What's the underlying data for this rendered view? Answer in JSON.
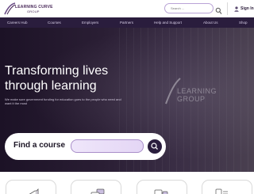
{
  "header": {
    "logo_text": "LEARNING CURVE",
    "logo_sub": "GROUP",
    "search_placeholder": "Search ...",
    "signin_label": "Sign In"
  },
  "nav": {
    "items": [
      "Careers Hub",
      "Courses",
      "Employers",
      "Partners",
      "Help and Support",
      "About Us",
      "Shop"
    ]
  },
  "hero": {
    "title": "Transforming lives through learning",
    "subtitle": "We make sure government funding for education goes to the people who need and want it the most",
    "logo_text_1": "LEARNING",
    "logo_text_2": "GROUP"
  },
  "find_course": {
    "label": "Find a course",
    "placeholder": ""
  },
  "icons": {
    "search": "search-icon",
    "user": "user-icon",
    "find_search": "search-icon"
  },
  "colors": {
    "brand_purple": "#2a1d3d",
    "accent_lavender": "#b9a3d6",
    "logo_purple": "#4a2a5a"
  }
}
